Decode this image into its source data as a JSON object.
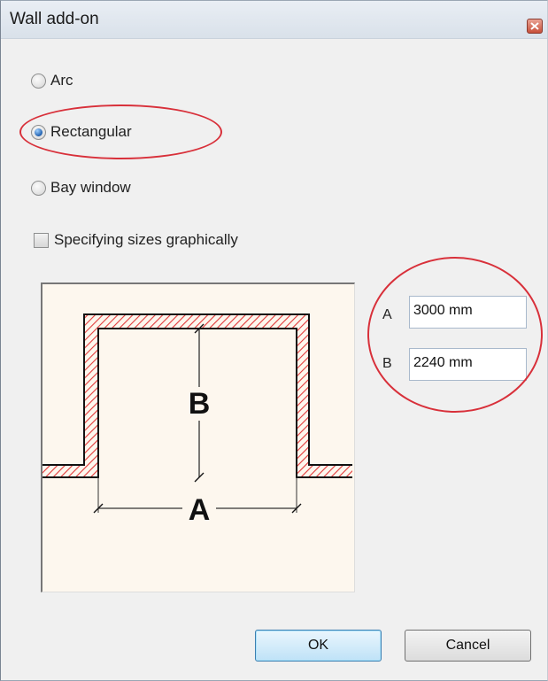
{
  "window": {
    "title": "Wall add-on"
  },
  "shape_options": [
    {
      "label": "Arc",
      "checked": false
    },
    {
      "label": "Rectangular",
      "checked": true
    },
    {
      "label": "Bay window",
      "checked": false
    }
  ],
  "graphic_sizes": {
    "label": "Specifying sizes graphically",
    "checked": false
  },
  "diagram": {
    "label_a": "A",
    "label_b": "B"
  },
  "dimensions": {
    "a": {
      "label": "A",
      "value": "3000 mm"
    },
    "b": {
      "label": "B",
      "value": "2240 mm"
    }
  },
  "buttons": {
    "ok": "OK",
    "cancel": "Cancel"
  },
  "colors": {
    "highlight": "#d8303a",
    "wall_hatch": "#e23a3a",
    "diagram_bg": "#fdf7ee"
  }
}
